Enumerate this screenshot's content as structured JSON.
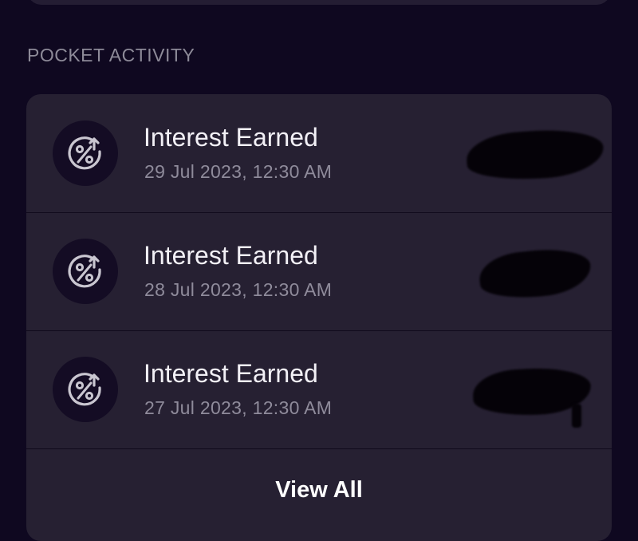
{
  "section": {
    "title": "POCKET ACTIVITY"
  },
  "activity": {
    "items": [
      {
        "icon": "interest-percent-icon",
        "title": "Interest Earned",
        "date": "29 Jul 2023, 12:30 AM"
      },
      {
        "icon": "interest-percent-icon",
        "title": "Interest Earned",
        "date": "28 Jul 2023, 12:30 AM"
      },
      {
        "icon": "interest-percent-icon",
        "title": "Interest Earned",
        "date": "27 Jul 2023, 12:30 AM"
      }
    ],
    "view_all_label": "View All"
  },
  "colors": {
    "background": "#0f0820",
    "card": "#262032",
    "icon_circle": "#140c24",
    "icon_stroke": "#c9c6d0",
    "primary_text": "#f2f0f6",
    "secondary_text": "#8f8b9b"
  }
}
